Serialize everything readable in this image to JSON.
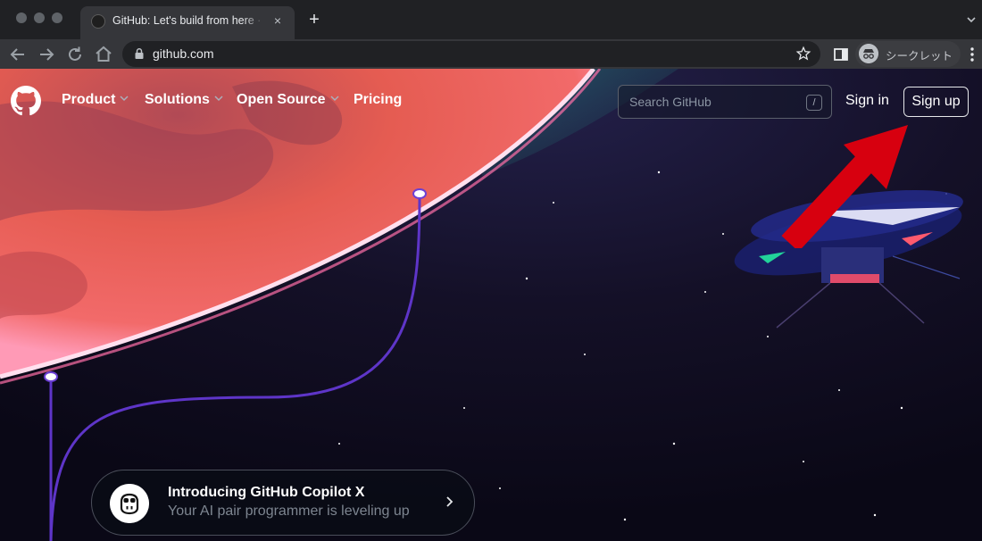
{
  "browser": {
    "tab": {
      "title": "GitHub: Let's build from here · GitHub",
      "close_glyph": "×"
    },
    "new_tab_glyph": "+",
    "address_bar": {
      "url": "github.com"
    },
    "profile": {
      "label": "シークレット"
    }
  },
  "header": {
    "nav": [
      {
        "label": "Product",
        "has_dropdown": true
      },
      {
        "label": "Solutions",
        "has_dropdown": true
      },
      {
        "label": "Open Source",
        "has_dropdown": true
      },
      {
        "label": "Pricing",
        "has_dropdown": false
      }
    ],
    "search": {
      "placeholder": "Search GitHub",
      "shortcut": "/"
    },
    "sign_in": "Sign in",
    "sign_up": "Sign up"
  },
  "hero": {
    "copilot_banner": {
      "title": "Introducing GitHub Copilot X",
      "subtitle": "Your AI pair programmer is leveling up"
    }
  },
  "annotation": {
    "type": "red-arrow",
    "points_to": "sign-up-button",
    "color": "#d7000f"
  },
  "colors": {
    "page_background": "#0e0b1e",
    "planet": "#e2574c",
    "planet_rim": "#ffd6e8",
    "trail": "#6b3fd4",
    "chrome_dark": "#202124",
    "chrome_toolbar": "#35363a"
  }
}
